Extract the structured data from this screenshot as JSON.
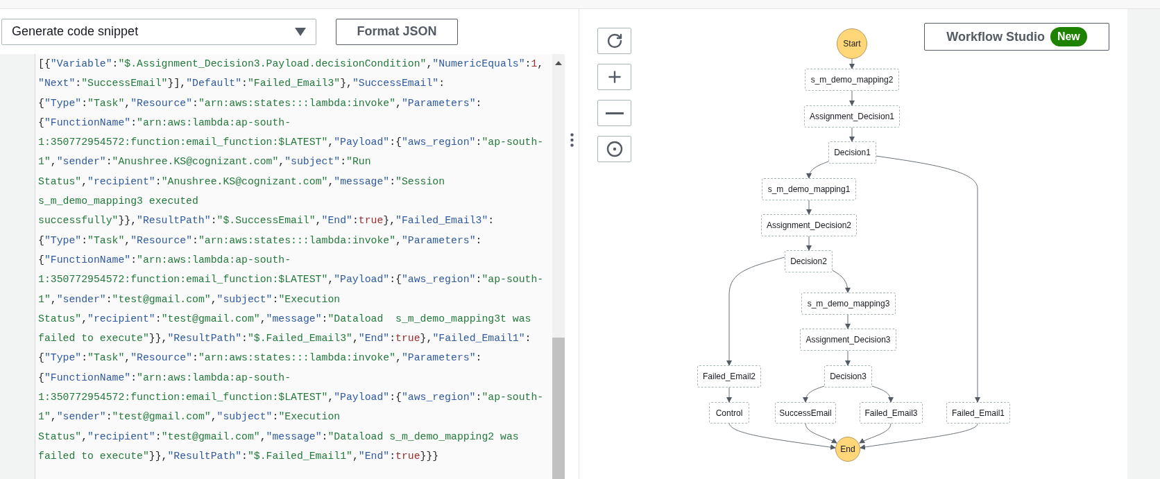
{
  "toolbar": {
    "snippet_select": {
      "value": "Generate code snippet"
    },
    "format_button": "Format JSON"
  },
  "code_lines": [
    [
      {
        "kind": "punct",
        "text": "[{"
      },
      {
        "kind": "key",
        "text": "\"Variable\""
      },
      {
        "kind": "punct",
        "text": ":"
      },
      {
        "kind": "str",
        "text": "\"$.Assignment_Decision3.Payload.decisionCondition\""
      },
      {
        "kind": "punct",
        "text": ","
      },
      {
        "kind": "key",
        "text": "\"NumericEquals\""
      },
      {
        "kind": "punct",
        "text": ":"
      },
      {
        "kind": "lit",
        "text": "1"
      },
      {
        "kind": "punct",
        "text": ","
      }
    ],
    [
      {
        "kind": "key",
        "text": "\"Next\""
      },
      {
        "kind": "punct",
        "text": ":"
      },
      {
        "kind": "str",
        "text": "\"SuccessEmail\""
      },
      {
        "kind": "punct",
        "text": "}],"
      },
      {
        "kind": "key",
        "text": "\"Default\""
      },
      {
        "kind": "punct",
        "text": ":"
      },
      {
        "kind": "str",
        "text": "\"Failed_Email3\""
      },
      {
        "kind": "punct",
        "text": "},"
      },
      {
        "kind": "key",
        "text": "\"SuccessEmail\""
      },
      {
        "kind": "punct",
        "text": ":"
      }
    ],
    [
      {
        "kind": "punct",
        "text": "{"
      },
      {
        "kind": "key",
        "text": "\"Type\""
      },
      {
        "kind": "punct",
        "text": ":"
      },
      {
        "kind": "str",
        "text": "\"Task\""
      },
      {
        "kind": "punct",
        "text": ","
      },
      {
        "kind": "key",
        "text": "\"Resource\""
      },
      {
        "kind": "punct",
        "text": ":"
      },
      {
        "kind": "str",
        "text": "\"arn:aws:states:::lambda:invoke\""
      },
      {
        "kind": "punct",
        "text": ","
      },
      {
        "kind": "key",
        "text": "\"Parameters\""
      },
      {
        "kind": "punct",
        "text": ":"
      }
    ],
    [
      {
        "kind": "punct",
        "text": "{"
      },
      {
        "kind": "key",
        "text": "\"FunctionName\""
      },
      {
        "kind": "punct",
        "text": ":"
      },
      {
        "kind": "str",
        "text": "\"arn:aws:lambda:ap-south-"
      }
    ],
    [
      {
        "kind": "str",
        "text": "1:350772954572:function:email_function:$LATEST\""
      },
      {
        "kind": "punct",
        "text": ","
      },
      {
        "kind": "key",
        "text": "\"Payload\""
      },
      {
        "kind": "punct",
        "text": ":{"
      },
      {
        "kind": "key",
        "text": "\"aws_region\""
      },
      {
        "kind": "punct",
        "text": ":"
      },
      {
        "kind": "str",
        "text": "\"ap-south-"
      }
    ],
    [
      {
        "kind": "str",
        "text": "1\""
      },
      {
        "kind": "punct",
        "text": ","
      },
      {
        "kind": "key",
        "text": "\"sender\""
      },
      {
        "kind": "punct",
        "text": ":"
      },
      {
        "kind": "str",
        "text": "\"Anushree.KS@cognizant.com\""
      },
      {
        "kind": "punct",
        "text": ","
      },
      {
        "kind": "key",
        "text": "\"subject\""
      },
      {
        "kind": "punct",
        "text": ":"
      },
      {
        "kind": "str",
        "text": "\"Run"
      }
    ],
    [
      {
        "kind": "str",
        "text": "Status\""
      },
      {
        "kind": "punct",
        "text": ","
      },
      {
        "kind": "key",
        "text": "\"recipient\""
      },
      {
        "kind": "punct",
        "text": ":"
      },
      {
        "kind": "str",
        "text": "\"Anushree.KS@cognizant.com\""
      },
      {
        "kind": "punct",
        "text": ","
      },
      {
        "kind": "key",
        "text": "\"message\""
      },
      {
        "kind": "punct",
        "text": ":"
      },
      {
        "kind": "str",
        "text": "\"Session"
      }
    ],
    [
      {
        "kind": "str",
        "text": "s_m_demo_mapping3 executed"
      }
    ],
    [
      {
        "kind": "str",
        "text": "successfully\""
      },
      {
        "kind": "punct",
        "text": "}},"
      },
      {
        "kind": "key",
        "text": "\"ResultPath\""
      },
      {
        "kind": "punct",
        "text": ":"
      },
      {
        "kind": "str",
        "text": "\"$.SuccessEmail\""
      },
      {
        "kind": "punct",
        "text": ","
      },
      {
        "kind": "key",
        "text": "\"End\""
      },
      {
        "kind": "punct",
        "text": ":"
      },
      {
        "kind": "lit",
        "text": "true"
      },
      {
        "kind": "punct",
        "text": "},"
      },
      {
        "kind": "key",
        "text": "\"Failed_Email3\""
      },
      {
        "kind": "punct",
        "text": ":"
      }
    ],
    [
      {
        "kind": "punct",
        "text": "{"
      },
      {
        "kind": "key",
        "text": "\"Type\""
      },
      {
        "kind": "punct",
        "text": ":"
      },
      {
        "kind": "str",
        "text": "\"Task\""
      },
      {
        "kind": "punct",
        "text": ","
      },
      {
        "kind": "key",
        "text": "\"Resource\""
      },
      {
        "kind": "punct",
        "text": ":"
      },
      {
        "kind": "str",
        "text": "\"arn:aws:states:::lambda:invoke\""
      },
      {
        "kind": "punct",
        "text": ","
      },
      {
        "kind": "key",
        "text": "\"Parameters\""
      },
      {
        "kind": "punct",
        "text": ":"
      }
    ],
    [
      {
        "kind": "punct",
        "text": "{"
      },
      {
        "kind": "key",
        "text": "\"FunctionName\""
      },
      {
        "kind": "punct",
        "text": ":"
      },
      {
        "kind": "str",
        "text": "\"arn:aws:lambda:ap-south-"
      }
    ],
    [
      {
        "kind": "str",
        "text": "1:350772954572:function:email_function:$LATEST\""
      },
      {
        "kind": "punct",
        "text": ","
      },
      {
        "kind": "key",
        "text": "\"Payload\""
      },
      {
        "kind": "punct",
        "text": ":{"
      },
      {
        "kind": "key",
        "text": "\"aws_region\""
      },
      {
        "kind": "punct",
        "text": ":"
      },
      {
        "kind": "str",
        "text": "\"ap-south-"
      }
    ],
    [
      {
        "kind": "str",
        "text": "1\""
      },
      {
        "kind": "punct",
        "text": ","
      },
      {
        "kind": "key",
        "text": "\"sender\""
      },
      {
        "kind": "punct",
        "text": ":"
      },
      {
        "kind": "str",
        "text": "\"test@gmail.com\""
      },
      {
        "kind": "punct",
        "text": ","
      },
      {
        "kind": "key",
        "text": "\"subject\""
      },
      {
        "kind": "punct",
        "text": ":"
      },
      {
        "kind": "str",
        "text": "\"Execution"
      }
    ],
    [
      {
        "kind": "str",
        "text": "Status\""
      },
      {
        "kind": "punct",
        "text": ","
      },
      {
        "kind": "key",
        "text": "\"recipient\""
      },
      {
        "kind": "punct",
        "text": ":"
      },
      {
        "kind": "str",
        "text": "\"test@gmail.com\""
      },
      {
        "kind": "punct",
        "text": ","
      },
      {
        "kind": "key",
        "text": "\"message\""
      },
      {
        "kind": "punct",
        "text": ":"
      },
      {
        "kind": "str",
        "text": "\"Dataload  s_m_demo_mapping3t was"
      }
    ],
    [
      {
        "kind": "str",
        "text": "failed to execute\""
      },
      {
        "kind": "punct",
        "text": "}},"
      },
      {
        "kind": "key",
        "text": "\"ResultPath\""
      },
      {
        "kind": "punct",
        "text": ":"
      },
      {
        "kind": "str",
        "text": "\"$.Failed_Email3\""
      },
      {
        "kind": "punct",
        "text": ","
      },
      {
        "kind": "key",
        "text": "\"End\""
      },
      {
        "kind": "punct",
        "text": ":"
      },
      {
        "kind": "lit",
        "text": "true"
      },
      {
        "kind": "punct",
        "text": "},"
      },
      {
        "kind": "key",
        "text": "\"Failed_Email1\""
      },
      {
        "kind": "punct",
        "text": ":"
      }
    ],
    [
      {
        "kind": "punct",
        "text": "{"
      },
      {
        "kind": "key",
        "text": "\"Type\""
      },
      {
        "kind": "punct",
        "text": ":"
      },
      {
        "kind": "str",
        "text": "\"Task\""
      },
      {
        "kind": "punct",
        "text": ","
      },
      {
        "kind": "key",
        "text": "\"Resource\""
      },
      {
        "kind": "punct",
        "text": ":"
      },
      {
        "kind": "str",
        "text": "\"arn:aws:states:::lambda:invoke\""
      },
      {
        "kind": "punct",
        "text": ","
      },
      {
        "kind": "key",
        "text": "\"Parameters\""
      },
      {
        "kind": "punct",
        "text": ":"
      }
    ],
    [
      {
        "kind": "punct",
        "text": "{"
      },
      {
        "kind": "key",
        "text": "\"FunctionName\""
      },
      {
        "kind": "punct",
        "text": ":"
      },
      {
        "kind": "str",
        "text": "\"arn:aws:lambda:ap-south-"
      }
    ],
    [
      {
        "kind": "str",
        "text": "1:350772954572:function:email_function:$LATEST\""
      },
      {
        "kind": "punct",
        "text": ","
      },
      {
        "kind": "key",
        "text": "\"Payload\""
      },
      {
        "kind": "punct",
        "text": ":{"
      },
      {
        "kind": "key",
        "text": "\"aws_region\""
      },
      {
        "kind": "punct",
        "text": ":"
      },
      {
        "kind": "str",
        "text": "\"ap-south-"
      }
    ],
    [
      {
        "kind": "str",
        "text": "1\""
      },
      {
        "kind": "punct",
        "text": ","
      },
      {
        "kind": "key",
        "text": "\"sender\""
      },
      {
        "kind": "punct",
        "text": ":"
      },
      {
        "kind": "str",
        "text": "\"test@gmail.com\""
      },
      {
        "kind": "punct",
        "text": ","
      },
      {
        "kind": "key",
        "text": "\"subject\""
      },
      {
        "kind": "punct",
        "text": ":"
      },
      {
        "kind": "str",
        "text": "\"Execution"
      }
    ],
    [
      {
        "kind": "str",
        "text": "Status\""
      },
      {
        "kind": "punct",
        "text": ","
      },
      {
        "kind": "key",
        "text": "\"recipient\""
      },
      {
        "kind": "punct",
        "text": ":"
      },
      {
        "kind": "str",
        "text": "\"test@gmail.com\""
      },
      {
        "kind": "punct",
        "text": ","
      },
      {
        "kind": "key",
        "text": "\"message\""
      },
      {
        "kind": "punct",
        "text": ":"
      },
      {
        "kind": "str",
        "text": "\"Dataload s_m_demo_mapping2 was"
      }
    ],
    [
      {
        "kind": "str",
        "text": "failed to execute\""
      },
      {
        "kind": "punct",
        "text": "}},"
      },
      {
        "kind": "key",
        "text": "\"ResultPath\""
      },
      {
        "kind": "punct",
        "text": ":"
      },
      {
        "kind": "str",
        "text": "\"$.Failed_Email1\""
      },
      {
        "kind": "punct",
        "text": ","
      },
      {
        "kind": "key",
        "text": "\"End\""
      },
      {
        "kind": "punct",
        "text": ":"
      },
      {
        "kind": "lit",
        "text": "true"
      },
      {
        "kind": "punct",
        "text": "}}}"
      }
    ]
  ],
  "workflow_studio": {
    "label": "Workflow Studio",
    "badge": "New"
  },
  "nodes": [
    {
      "kind": "terminal",
      "label": "Start"
    },
    {
      "kind": "task",
      "label": "s_m_demo_mapping2"
    },
    {
      "kind": "task",
      "label": "Assignment_Decision1"
    },
    {
      "kind": "task",
      "label": "Decision1"
    },
    {
      "kind": "task",
      "label": "s_m_demo_mapping1"
    },
    {
      "kind": "task",
      "label": "Assignment_Decision2"
    },
    {
      "kind": "task",
      "label": "Decision2"
    },
    {
      "kind": "task",
      "label": "s_m_demo_mapping3"
    },
    {
      "kind": "task",
      "label": "Assignment_Decision3"
    },
    {
      "kind": "task",
      "label": "Decision3"
    },
    {
      "kind": "task",
      "label": "Failed_Email2"
    },
    {
      "kind": "task",
      "label": "Control"
    },
    {
      "kind": "task",
      "label": "SuccessEmail"
    },
    {
      "kind": "task",
      "label": "Failed_Email3"
    },
    {
      "kind": "task",
      "label": "Failed_Email1"
    },
    {
      "kind": "terminal",
      "label": "End"
    }
  ]
}
